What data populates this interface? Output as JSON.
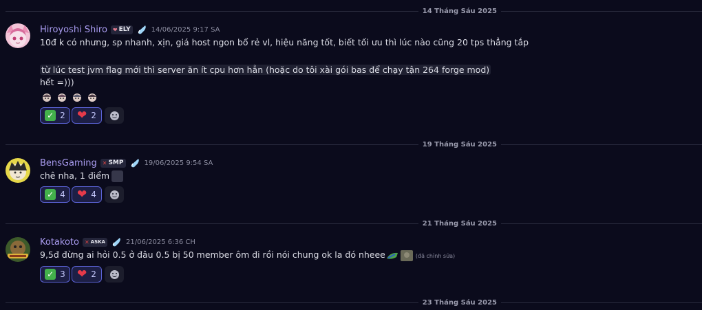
{
  "dividers": [
    "14 Tháng Sáu 2025",
    "19 Tháng Sáu 2025",
    "21 Tháng Sáu 2025",
    "23 Tháng Sáu 2025"
  ],
  "messages": [
    {
      "author": "Hiroyoshi Shiro",
      "tag": "ELY",
      "timestamp": "14/06/2025 9:17 SA",
      "lines": [
        "10đ k có nhưng, sp nhanh, xịn, giá host ngon bổ rẻ vl, hiệu năng tốt, biết tối ưu thì lúc nào cũng 20 tps thẳng tắp",
        "từ lúc test jvm flag mới thì server ăn ít cpu hơn hẳn (hoặc do tôi xài gói bas để chạy tận 264 forge mod)",
        "hết =)))"
      ],
      "reactions": [
        {
          "emoji": "check",
          "count": "2"
        },
        {
          "emoji": "heart",
          "count": "2"
        }
      ]
    },
    {
      "author": "BensGaming",
      "tag": "SMP",
      "timestamp": "19/06/2025 9:54 SA",
      "lines": [
        "chê nha, 1 điểm"
      ],
      "reactions": [
        {
          "emoji": "check",
          "count": "4"
        },
        {
          "emoji": "heart",
          "count": "4"
        }
      ]
    },
    {
      "author": "Kotakoto",
      "tag": "ASKA",
      "timestamp": "21/06/2025 6:36 CH",
      "lines": [
        "9,5đ đừng ai hỏi 0.5 ở đâu 0.5 bị 50 member ôm đi rồi nói chung ok la đó nheee"
      ],
      "edited": "(đã chỉnh sửa)",
      "reactions": [
        {
          "emoji": "check",
          "count": "3"
        },
        {
          "emoji": "heart",
          "count": "2"
        }
      ]
    }
  ],
  "colors": {
    "background": "#0b0b1c",
    "author": "#a99cf0",
    "reaction_border": "#5b63d6",
    "reaction_bg": "#1d1f45"
  },
  "icons": {
    "boost": "nitro-boost-icon",
    "check": "check-mark-button-icon",
    "heart": "red-heart-icon",
    "add_reaction": "add-reaction-icon"
  }
}
